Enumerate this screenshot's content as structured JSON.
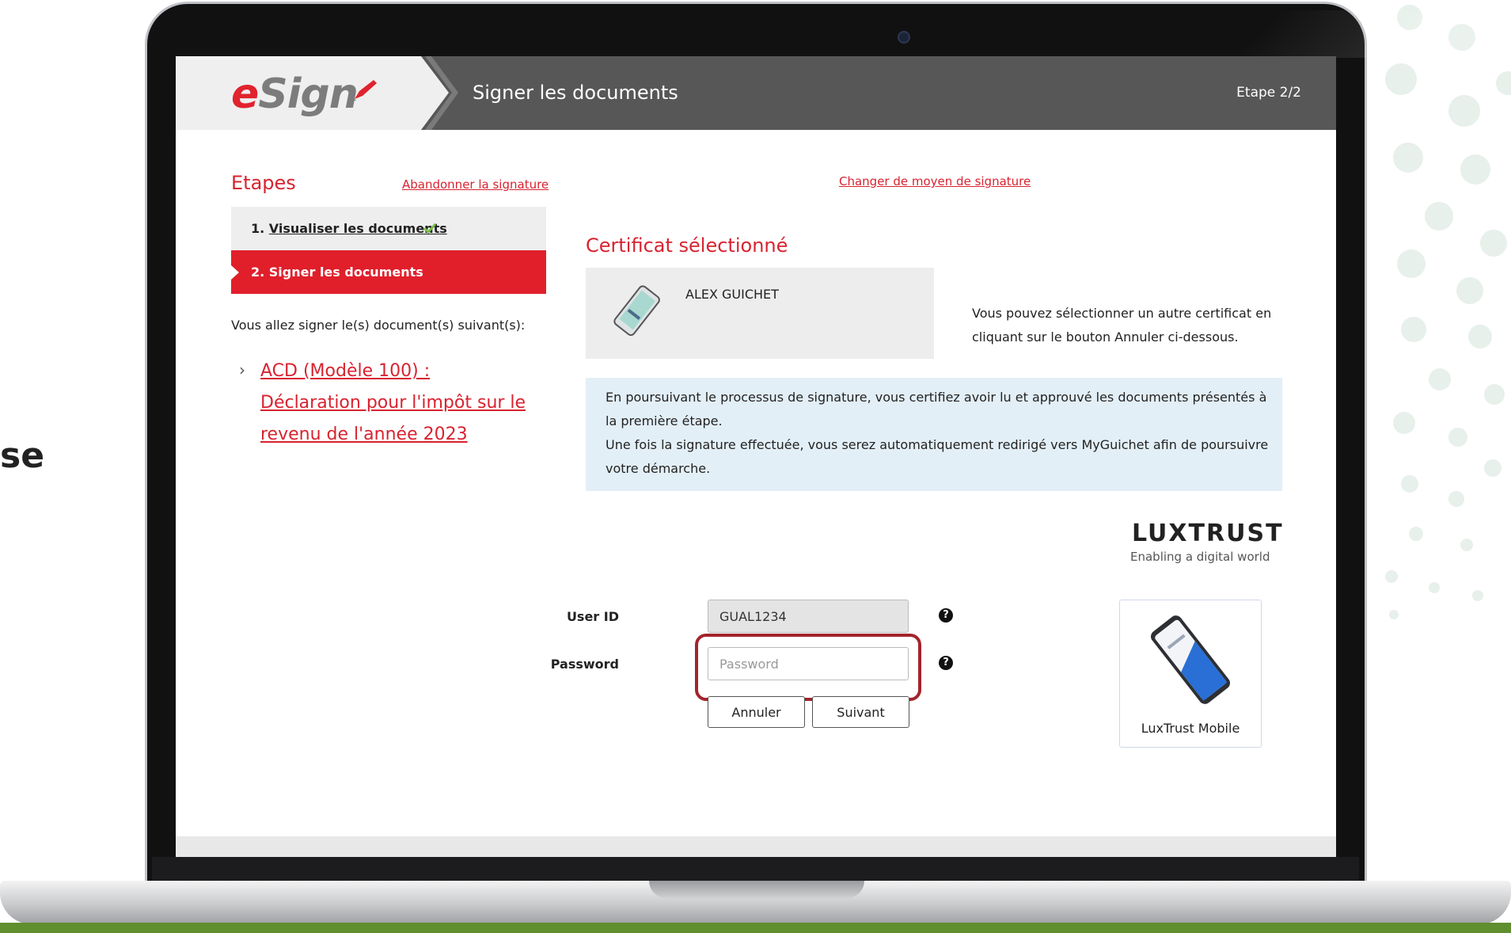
{
  "background": {
    "partial_text": "se"
  },
  "header": {
    "logo_e": "e",
    "logo_rest": "Sign",
    "title": "Signer les documents",
    "step_indicator": "Etape 2/2"
  },
  "steps": {
    "title": "Etapes",
    "abandon_link": "Abandonner la signature",
    "step1_number": "1.",
    "step1_label": "Visualiser les documents",
    "step2_label": "2. Signer les documents"
  },
  "documents": {
    "intro": "Vous allez signer le(s) document(s) suivant(s):",
    "items": [
      {
        "label": "ACD (Modèle 100) : Déclaration pour l'impôt sur le revenu de l'année 2023"
      }
    ]
  },
  "change_link": "Changer de moyen de signature",
  "certificate": {
    "title": "Certificat sélectionné",
    "holder": "ALEX GUICHET",
    "help": "Vous pouvez sélectionner un autre certificat en cliquant sur le bouton Annuler ci-dessous."
  },
  "notice": {
    "line1": "En poursuivant le processus de signature, vous certifiez avoir lu et approuvé les documents présentés à la première étape.",
    "line2": "Une fois la signature effectuée, vous serez automatiquement redirigé vers MyGuichet afin de poursuivre votre démarche."
  },
  "luxtrust": {
    "brand": "LUXTRUST",
    "tagline": "Enabling a digital world",
    "mobile_label": "LuxTrust Mobile"
  },
  "form": {
    "user_id_label": "User ID",
    "user_id_value": "GUAL1234",
    "password_label": "Password",
    "password_placeholder": "Password",
    "help_glyph": "?",
    "cancel_button": "Annuler",
    "next_button": "Suivant"
  },
  "colors": {
    "accent_red": "#d82330",
    "header_gray": "#575758",
    "notice_blue": "#e3eff7",
    "highlight_border": "#a3242c"
  }
}
